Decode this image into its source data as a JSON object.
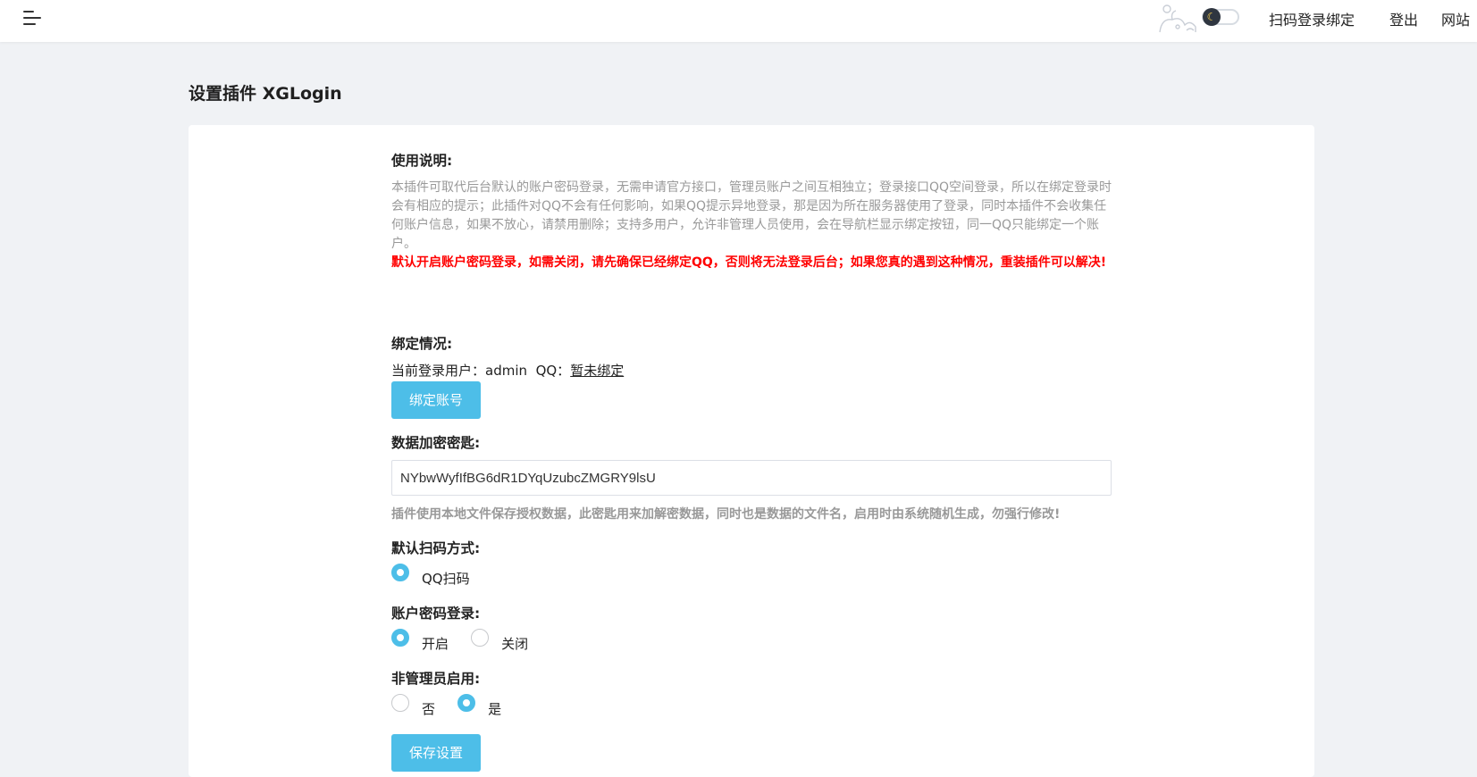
{
  "topbar": {
    "bind_label": "扫码登录绑定",
    "logout_label": "登出",
    "site_label": "网站"
  },
  "page": {
    "title": "设置插件 XGLogin"
  },
  "usage": {
    "title": "使用说明:",
    "description": "本插件可取代后台默认的账户密码登录，无需申请官方接口，管理员账户之间互相独立；登录接口QQ空间登录，所以在绑定登录时会有相应的提示；此插件对QQ不会有任何影响，如果QQ提示异地登录，那是因为所在服务器使用了登录，同时本插件不会收集任何账户信息，如果不放心，请禁用删除；支持多用户，允许非管理人员使用，会在导航栏显示绑定按钮，同一QQ只能绑定一个账户。",
    "warning": "默认开启账户密码登录，如需关闭，请先确保已经绑定QQ，否则将无法登录后台；如果您真的遇到这种情况，重装插件可以解决!"
  },
  "binding": {
    "title": "绑定情况:",
    "user_label": "当前登录用户：",
    "username": "admin",
    "qq_label": "QQ：",
    "qq_status": "暂未绑定",
    "bind_button": "绑定账号"
  },
  "encryption": {
    "title": "数据加密密匙:",
    "key_value": "NYbwWyfIfBG6dR1DYqUzubcZMGRY9lsU",
    "help": "插件使用本地文件保存授权数据，此密匙用来加解密数据，同时也是数据的文件名，启用时由系统随机生成，勿强行修改!"
  },
  "scan_mode": {
    "title": "默认扫码方式:",
    "options": [
      {
        "label": "QQ扫码",
        "checked": true
      }
    ]
  },
  "password_login": {
    "title": "账户密码登录:",
    "options": [
      {
        "label": "开启",
        "checked": true
      },
      {
        "label": "关闭",
        "checked": false
      }
    ]
  },
  "non_admin": {
    "title": "非管理员启用:",
    "options": [
      {
        "label": "否",
        "checked": false
      },
      {
        "label": "是",
        "checked": true
      }
    ]
  },
  "save_button": "保存设置",
  "colors": {
    "accent": "#4dbee8",
    "warning": "#ff0000",
    "background": "#f0f2f5"
  },
  "icons": {
    "menu": "menu-icon",
    "theme_toggle": "moon-icon",
    "mascot": "mascot-illustration"
  }
}
